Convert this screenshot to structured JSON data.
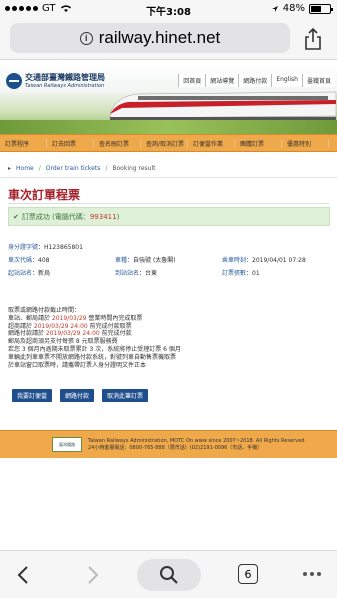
{
  "status_bar": {
    "carrier": "GT",
    "time": "下午3:08",
    "battery": "48%"
  },
  "address_bar": {
    "url": "railway.hinet.net"
  },
  "header": {
    "logo_zh": "交通部臺灣鐵路管理局",
    "logo_en": "Taiwan Railways Administration",
    "top_links": [
      "回首頁",
      "網站導覽",
      "網路付款",
      "English",
      "臺鐵首頁"
    ]
  },
  "nav": {
    "items": [
      "訂票程序",
      "訂去回票",
      "查名刪訂票",
      "查詢/取消訂票",
      "訂便當作業",
      "團體訂票",
      "優惠特別"
    ]
  },
  "breadcrumb": {
    "home": "Home",
    "order": "Order train tickets",
    "current": "Booking result"
  },
  "page": {
    "title": "車次訂單程票",
    "success_text": "訂票成功 (電腦代碼：",
    "success_code": "993411",
    "success_close": ")"
  },
  "details": {
    "id_label": "身分證字號",
    "id_value": "H123865801",
    "train_no_label": "車次代碼",
    "train_no_value": "408",
    "train_type_label": "車種",
    "train_type_value": "自強號 (太魯閣)",
    "date_label": "乘車時刻",
    "date_value": "2019/04/01 07:28",
    "from_label": "起站站名",
    "from_value": "新烏",
    "to_label": "到站站名",
    "to_value": "台東",
    "count_label": "訂票張數",
    "count_value": "01"
  },
  "notes": {
    "line1": "取票或網路付款截止時間：",
    "line2_pre": "車站、郵局請於 ",
    "line2_red": "2019/03/29",
    "line2_post": " 營業時間內完成取票",
    "line3_pre": "超商請於 ",
    "line3_red": "2019/03/29 24:00",
    "line3_post": " 前完成付款取票",
    "line4_pre": "網路付款請於 ",
    "line4_red": "2019/03/29 24:00",
    "line4_post": " 前完成付款",
    "line5": "郵局及超商須另支付每張 8 元取票服務費",
    "line6": "若您 3 個月內逾期未取票累計 3 次，系統將停止受理訂票 6 個月",
    "line7": "車輛此列車車票不開放網路付款系統，對號列車自動售票機取票",
    "line8": "於車站窗口取票時，請攜帶訂票人身分證明文件正本"
  },
  "buttons": {
    "home": "我要訂便當",
    "pay": "網路付款",
    "cancel": "取消此筆訂票"
  },
  "footer": {
    "logo": "臺灣鐵路",
    "line1": "Taiwan Railways Administration, MOTC On www since 2007~2018. All Rights Reserved.",
    "line2": "24小時客服電話：0800-765-888（限市話）(02)2191-0096（市話、手機）"
  },
  "toolbar": {
    "tabs_count": "6"
  }
}
